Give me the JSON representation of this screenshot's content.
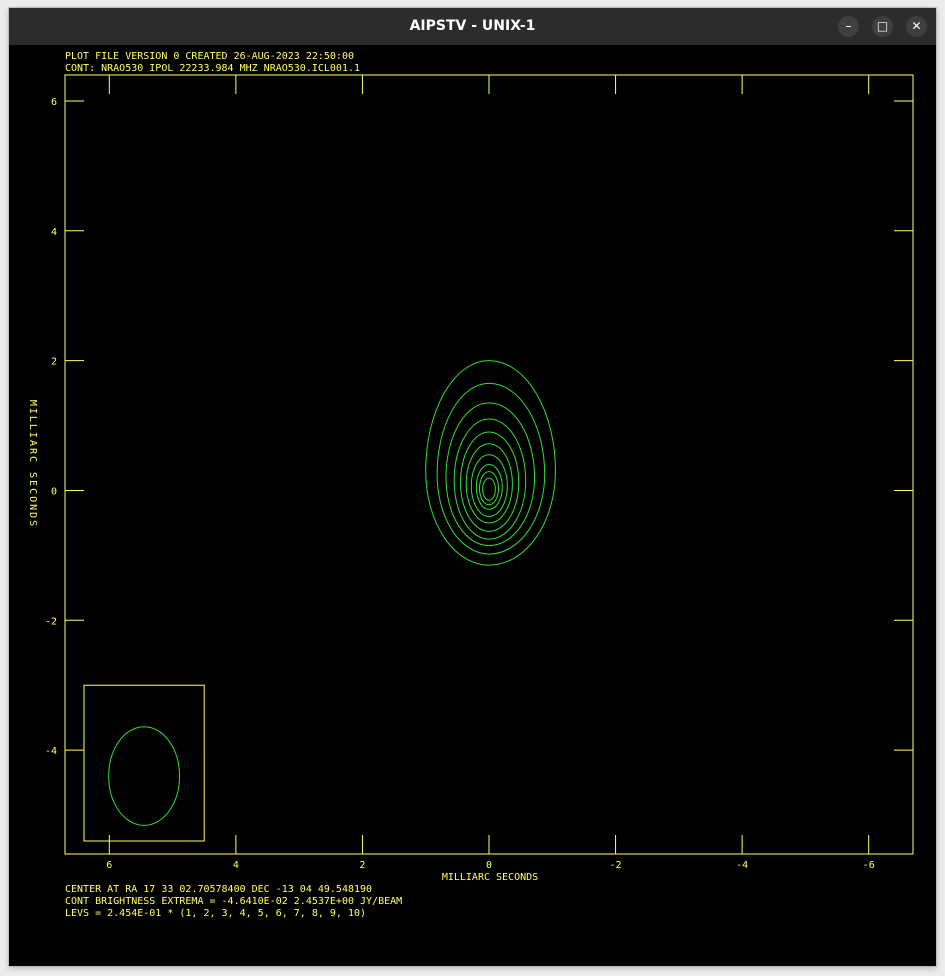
{
  "window": {
    "title": "AIPSTV - UNIX-1",
    "controls": {
      "minimize_icon": "minimize-icon",
      "maximize_icon": "maximize-icon",
      "close_icon": "close-icon"
    }
  },
  "colors": {
    "axis": "#ffff66",
    "contour": "#33dd33",
    "background": "#000000",
    "titlebar": "#2c2c2c"
  },
  "plot": {
    "header_line1": "PLOT FILE VERSION 0  CREATED 26-AUG-2023 22:50:00",
    "header_line2": "CONT: NRAO530  IPOL  22233.984 MHZ  NRAO530.ICL001.1",
    "footer_line1": "CENTER AT RA 17 33 02.70578400  DEC -13 04 49.548190",
    "footer_line2": "CONT BRIGHTNESS EXTREMA = -4.6410E-02 2.4537E+00 JY/BEAM",
    "footer_line3": "LEVS = 2.454E-01 * (1, 2, 3, 4, 5, 6, 7, 8, 9, 10)"
  },
  "chart_data": {
    "type": "contour",
    "xlabel": "MILLIARC SECONDS",
    "ylabel": "MILLIARC SECONDS",
    "x_reversed": true,
    "xlim": [
      6.7,
      -6.7
    ],
    "ylim": [
      -5.6,
      6.4
    ],
    "x_ticks": [
      6,
      4,
      2,
      0,
      -2,
      -4,
      -6
    ],
    "x_tick_labels": [
      "6",
      "4",
      "2",
      "0",
      "-2",
      "-4",
      "-6"
    ],
    "y_ticks": [
      6,
      4,
      2,
      0,
      -2,
      -4
    ],
    "y_tick_labels": [
      "6",
      "4",
      "2",
      "0",
      "-2",
      "-4"
    ],
    "contours": [
      {
        "level": 1,
        "cx": 0.0,
        "cy": 0.3,
        "rx_left": 1.0,
        "rx_right": 1.05,
        "ry_top": 1.7,
        "ry_bottom": 1.45
      },
      {
        "level": 2,
        "cx": 0.0,
        "cy": 0.25,
        "rx_left": 0.82,
        "rx_right": 0.88,
        "ry_top": 1.4,
        "ry_bottom": 1.23
      },
      {
        "level": 3,
        "cx": 0.0,
        "cy": 0.2,
        "rx_left": 0.68,
        "rx_right": 0.72,
        "ry_top": 1.15,
        "ry_bottom": 1.05
      },
      {
        "level": 4,
        "cx": 0.0,
        "cy": 0.15,
        "rx_left": 0.55,
        "rx_right": 0.58,
        "ry_top": 0.95,
        "ry_bottom": 0.9
      },
      {
        "level": 5,
        "cx": 0.0,
        "cy": 0.12,
        "rx_left": 0.45,
        "rx_right": 0.47,
        "ry_top": 0.78,
        "ry_bottom": 0.75
      },
      {
        "level": 6,
        "cx": 0.0,
        "cy": 0.1,
        "rx_left": 0.36,
        "rx_right": 0.37,
        "ry_top": 0.62,
        "ry_bottom": 0.6
      },
      {
        "level": 7,
        "cx": 0.0,
        "cy": 0.07,
        "rx_left": 0.28,
        "rx_right": 0.29,
        "ry_top": 0.48,
        "ry_bottom": 0.47
      },
      {
        "level": 8,
        "cx": 0.0,
        "cy": 0.05,
        "rx_left": 0.2,
        "rx_right": 0.21,
        "ry_top": 0.35,
        "ry_bottom": 0.34
      },
      {
        "level": 9,
        "cx": 0.0,
        "cy": 0.03,
        "rx_left": 0.15,
        "rx_right": 0.15,
        "ry_top": 0.26,
        "ry_bottom": 0.25
      },
      {
        "level": 10,
        "cx": 0.0,
        "cy": 0.02,
        "rx_left": 0.1,
        "rx_right": 0.1,
        "ry_top": 0.17,
        "ry_bottom": 0.17
      }
    ],
    "beam": {
      "cx": 5.45,
      "cy": -4.4,
      "rx": 0.56,
      "ry": 0.76,
      "box_x": [
        6.4,
        4.5
      ],
      "box_y": [
        -5.4,
        -3.0
      ]
    }
  }
}
